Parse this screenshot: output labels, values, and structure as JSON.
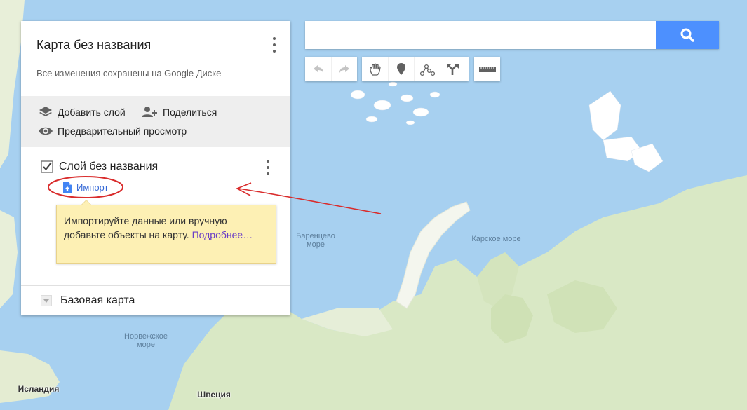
{
  "map": {
    "labels": {
      "barents": "Баренцево\nморе",
      "kara": "Карское море",
      "norwegian": "Норвежское\nморе",
      "iceland": "Исландия",
      "sweden": "Швеция"
    },
    "colors": {
      "water": "#a7d0f0",
      "land": "#d9e8c5",
      "land_light": "#e8efd9",
      "ice": "#ffffff"
    }
  },
  "panel": {
    "title": "Карта без названия",
    "saved_status": "Все изменения сохранены на Google Диске",
    "actions": {
      "add_layer": "Добавить слой",
      "share": "Поделиться",
      "preview": "Предварительный просмотр"
    },
    "layer": {
      "title": "Слой без названия",
      "checked": true,
      "import_label": "Импорт"
    },
    "tooltip": {
      "text": "Импортируйте данные или вручную добавьте объекты на карту.",
      "link": "Подробнее…"
    },
    "base_map_label": "Базовая карта"
  },
  "search": {
    "placeholder": "",
    "value": ""
  },
  "toolbar": {
    "icons": [
      "undo-icon",
      "redo-icon",
      "hand-icon",
      "marker-icon",
      "line-icon",
      "directions-icon",
      "ruler-icon"
    ]
  },
  "annotation": {
    "color": "#d92c2c"
  }
}
